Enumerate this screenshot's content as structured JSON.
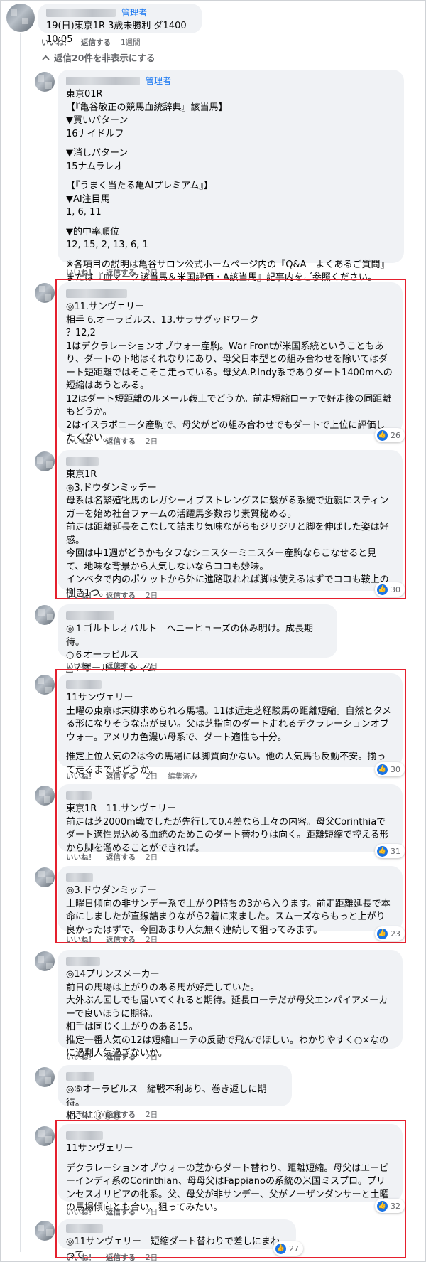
{
  "top_comment": {
    "badge": "管理者",
    "text": "19(日)東京1R 3歳未勝利 ダ1400 10:05",
    "actions": [
      "いいね！",
      "返信する",
      "1週間"
    ]
  },
  "hide_replies_label": "返信20件を非表示にする",
  "hide_replies_icon": "chevron-up-icon",
  "comments": [
    {
      "badge": "管理者",
      "paragraphs": [
        "東京01R\n【『亀谷敬正の競馬血統辞典』該当馬】\n▼買いパターン\n16ナイドルフ",
        "▼消しパターン\n15ナムラレオ",
        "【『うまく当たる亀AIプレミアム』】\n▼AI注目馬\n1, 6, 11",
        "▼的中率順位\n12, 15, 2, 13, 6, 1",
        "※各項目の説明は亀谷サロン公式ホームページ内の『Q&A　よくあるご質問』または『血マーク該当馬＆米国評価・A該当馬』記事内をご参照ください。"
      ],
      "actions": [
        "いいね！",
        "返信する",
        "2日"
      ]
    },
    {
      "paragraphs": [
        "◎11.サンヴェリー\n相手 6.オーラビルス、13.サラサグッドワーク\n？12,2\n1はデクラレーションオブウォー産駒。War Frontが米国系統ということもあり、ダートの下地はそれなりにあり、母父日本型との組み合わせを除いてはダート短距離ではそこそこ走っている。母父A.P.Indy系でありダート1400mへの短縮はあうとみる。\n12はダート短距離のルメール鞍上でどうか。前走短縮ローテで好走後の同距離もどうか。\n2はイスラボニータ産駒で、母父がどの組み合わせでもダートで上位に評価したくない。"
      ],
      "actions": [
        "いいね！",
        "返信する",
        "2日"
      ],
      "likes": "26"
    },
    {
      "paragraphs": [
        "東京1R\n◎3.ドウダンミッチー\n母系は名繁殖牝馬のレガシーオブストレングスに繋がる系統で近親にスティンガーを始め社台ファームの活躍馬多数おり素質秘める。\n前走は距離延長をこなして詰まり気味ながらもジリジリと脚を伸ばした姿は好感。\n今回は中1週がどうかもタフなシニスターミニスター産駒ならこなせると見て、地味な背景から人気しないならココも妙味。\nインベタで内のポケットから外に進路取れれば脚は使えるはずでココも鞍上の捌き1つ。"
      ],
      "actions": [
        "いいね！",
        "返信する",
        "2日"
      ],
      "likes": "30"
    },
    {
      "paragraphs": [
        "◎１ゴルトレオパルト　ヘニーヒューズの休み明け。成長期待。\n○６オーラビルス\n△７オールマキシマム"
      ],
      "actions": [
        "いいね！",
        "返信する",
        "2日"
      ]
    },
    {
      "paragraphs": [
        "11サンヴェリー\n土曜の東京は末脚求められる馬場。11は近走芝経験馬の距離短縮。自然とタメる形になりそうな点が良い。父は芝指向のダート走れるデクラレーションオブウォー。アメリカ色濃い母系で、ダート適性も十分。",
        "推定上位人気の2は今の馬場には脚質向かない。他の人気馬も反動不安。揃って走るまではどうか。"
      ],
      "actions": [
        "いいね！",
        "返信する",
        "2日",
        "編集済み"
      ],
      "likes": "30"
    },
    {
      "paragraphs": [
        "東京1R　11.サンヴェリー\n前走は芝2000m戦でしたが先行して0.4差なら上々の内容。母父Corinthiaでダート適性見込める血統のためこのダート替わりは向く。距離短縮で控える形から脚を溜めることができれば。"
      ],
      "actions": [
        "いいね！",
        "返信する",
        "2日"
      ],
      "likes": "31"
    },
    {
      "paragraphs": [
        "◎3.ドウダンミッチー\n土曜日傾向の非サンデー系で上がりP持ちの3から入ります。前走距離延長で本命にしましたが直線詰まりながら2着に来ました。スムーズならもっと上がり良かったはずで、今回あまり人気無く連続して狙ってみます。"
      ],
      "actions": [
        "いいね！",
        "返信する",
        "2日"
      ],
      "likes": "23"
    },
    {
      "paragraphs": [
        "◎14プリンスメーカー\n前日の馬場は上がりのある馬が好走していた。\n大外ぶん回しでも届いてくれると期待。延長ローテだが母父エンパイアメーカーで良いほうに期待。\n相手は同じく上がりのある15。\n推定一番人気の12は短縮ローテの反動で飛んでほしい。わかりやすく○×なのに過剰人気過ぎないか。"
      ],
      "actions": [
        "いいね！",
        "返信する",
        "2日"
      ]
    },
    {
      "paragraphs": [
        "◎⑥オーラビルス　緒戦不利あり、巻き返しに期待。\n相手に⑫⑬⑪"
      ],
      "actions": [
        "いいね！",
        "返信する",
        "2日"
      ]
    },
    {
      "paragraphs": [
        "11サンヴェリー",
        "デクラレーションオブウォーの芝からダート替わり、距離短縮。母父はエーピーインディ系のCorinthian、母母父はFappianoの系統の米国ミスプロ。プリンセスオリビアの牝系。父、母父が非サンデー、父がノーザンダンサーと土曜の馬場傾向とも合い、狙ってみたい。"
      ],
      "actions": [
        "いいね！",
        "返信する",
        "2日"
      ],
      "likes": "32"
    },
    {
      "paragraphs": [
        "◎11サンヴェリー　短縮ダート替わりで差しにまわって"
      ],
      "actions": [
        "いいね！",
        "返信する",
        "2日"
      ],
      "likes": "27"
    }
  ],
  "colors": {
    "bubble": "#f0f2f5",
    "admin_badge": "#1877f2",
    "highlight_border": "#e5202e",
    "like_icon": "#1b74e4",
    "meta_text": "#65676b"
  },
  "icons": {
    "like": "thumbs-up-icon"
  }
}
